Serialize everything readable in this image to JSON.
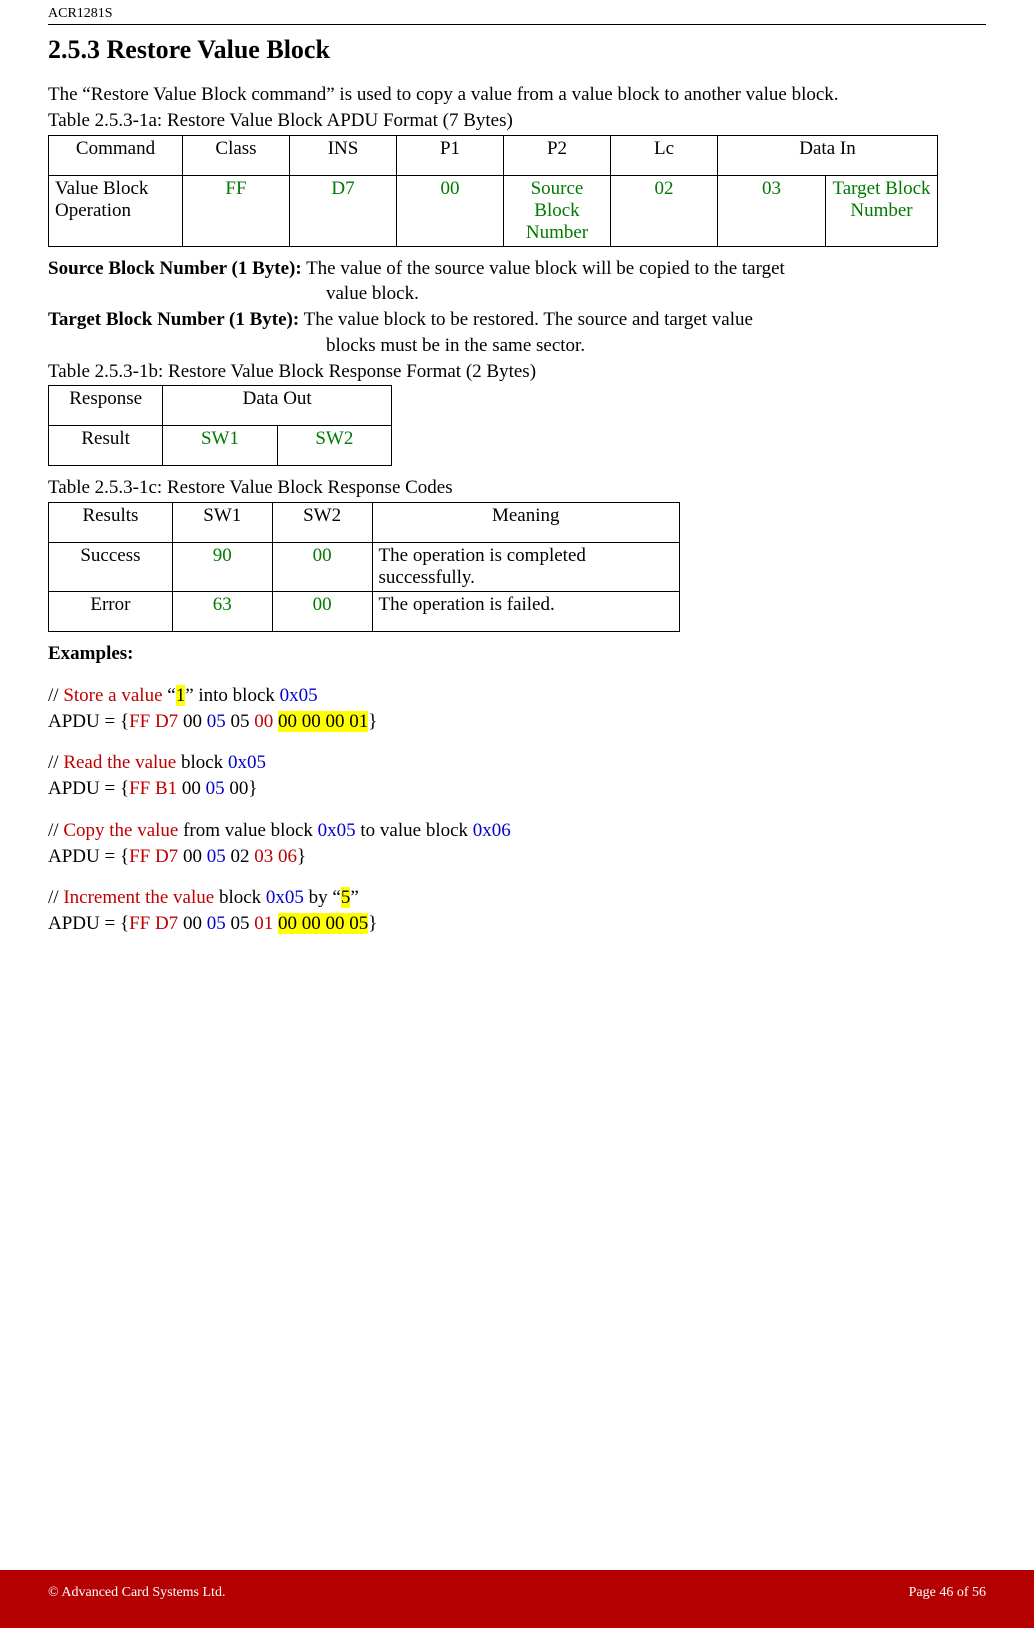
{
  "header": {
    "product": "ACR1281S"
  },
  "section": {
    "number": "2.5.3",
    "title": "Restore Value Block",
    "intro": "The “Restore Value Block command” is used to copy a value from a value block to another value block."
  },
  "table1": {
    "caption": "Table 2.5.3-1a: Restore Value Block APDU Format (7 Bytes)",
    "headers": [
      "Command",
      "Class",
      "INS",
      "P1",
      "P2",
      "Lc",
      "Data In"
    ],
    "row_label": "Value Block Operation",
    "values": {
      "class": "FF",
      "ins": "D7",
      "p1": "00",
      "p2": "Source Block Number",
      "lc": "02",
      "data1": "03",
      "data2": "Target Block Number"
    }
  },
  "fields": {
    "source_label": "Source Block Number (1 Byte):",
    "source_desc1": " The value of the source value block will be copied to the target",
    "source_desc2": "value block.",
    "target_label": "Target Block Number (1 Byte):",
    "target_desc1": " The value block to be restored. The source and target value",
    "target_desc2": "blocks must be in the same sector."
  },
  "table2": {
    "caption": "Table 2.5.3-1b: Restore Value Block Response Format (2 Bytes)",
    "headers": [
      "Response",
      "Data Out"
    ],
    "row_label": "Result",
    "values": {
      "sw1": "SW1",
      "sw2": "SW2"
    }
  },
  "table3": {
    "caption": "Table 2.5.3-1c: Restore Value  Block Response Codes",
    "headers": [
      "Results",
      "SW1",
      "SW2",
      "Meaning"
    ],
    "rows": [
      {
        "result": "Success",
        "sw1": "90",
        "sw2": "00",
        "meaning": "The operation is completed successfully."
      },
      {
        "result": "Error",
        "sw1": "63",
        "sw2": "00",
        "meaning": "The operation is failed."
      }
    ]
  },
  "examples": {
    "label": "Examples:",
    "ex1": {
      "c_pre": "// ",
      "c_red": "Store a value",
      "c_mid1": " “",
      "c_hl1": "1",
      "c_mid2": "” into block ",
      "c_blue": "0x05",
      "a_pre": "APDU = {",
      "a_red": "FF D7",
      "a_m1": " 00 ",
      "a_blue": "05",
      "a_m2": " 05 ",
      "a_red2": "00",
      "a_m3": " ",
      "a_hl": "00 00 00 01",
      "a_end": "}"
    },
    "ex2": {
      "c_pre": "// ",
      "c_red": "Read the value",
      "c_mid": " block ",
      "c_blue": "0x05",
      "a_pre": "APDU = {",
      "a_red": "FF B1",
      "a_m1": " 00 ",
      "a_blue": "05",
      "a_end": " 00}"
    },
    "ex3": {
      "c_pre": "// ",
      "c_red": "Copy the value",
      "c_m1": " from value block ",
      "c_blue1": "0x05",
      "c_m2": " to value block ",
      "c_blue2": "0x06",
      "a_pre": "APDU = {",
      "a_red": "FF D7",
      "a_m1": " 00 ",
      "a_blue": "05",
      "a_m2": " 02 ",
      "a_red2": "03 06",
      "a_end": "}"
    },
    "ex4": {
      "c_pre": "// ",
      "c_red": "Increment the value",
      "c_m1": " block ",
      "c_blue": "0x05",
      "c_m2": " by “",
      "c_hl": "5",
      "c_m3": "”",
      "a_pre": "APDU = {",
      "a_red": "FF D7",
      "a_m1": " 00 ",
      "a_blue": "05",
      "a_m2": " 05 ",
      "a_red2": "01",
      "a_m3": " ",
      "a_hl": "00 00 00 05",
      "a_end": "}"
    }
  },
  "footer": {
    "copyright": "© Advanced Card Systems Ltd.",
    "page": "Page 46 of 56"
  }
}
